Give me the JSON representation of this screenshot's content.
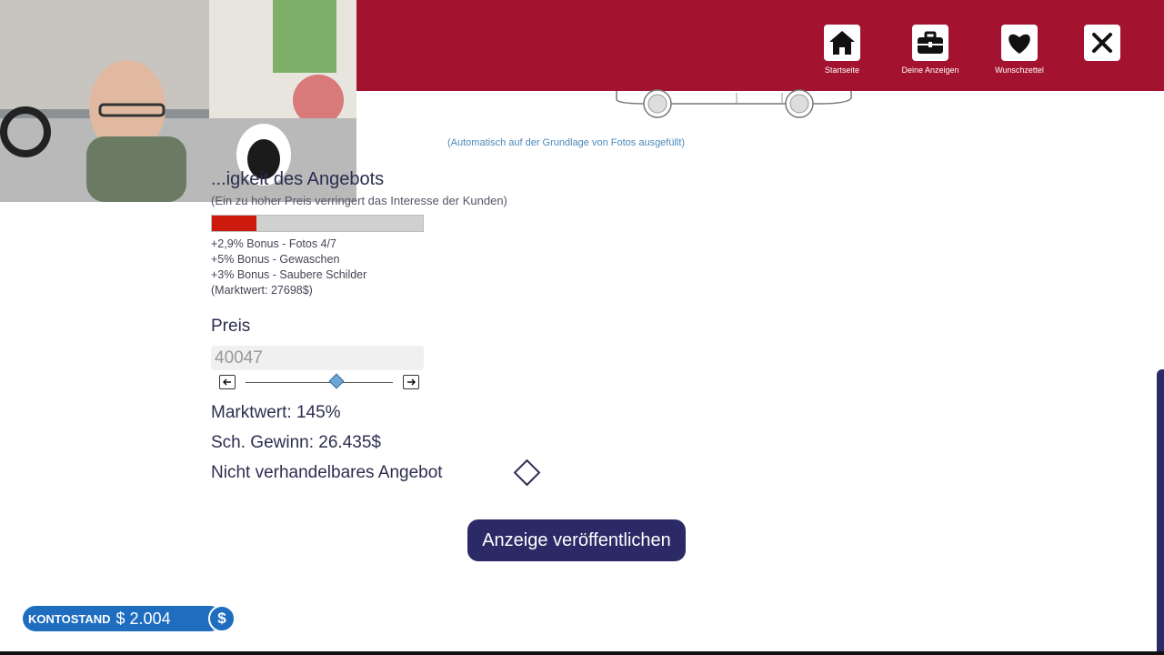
{
  "topbar": {
    "nav": [
      {
        "label": "Startseite",
        "icon": "home-icon"
      },
      {
        "label": "Deine Anzeigen",
        "icon": "briefcase-icon"
      },
      {
        "label": "Wunschzettel",
        "icon": "heart-icon"
      }
    ],
    "close_icon": "close-icon",
    "color": "#a3132f"
  },
  "auto_note": "(Automatisch auf der Grundlage von Fotos ausgefüllt)",
  "attractiveness": {
    "title": "...igkeit des Angebots",
    "subtitle": "(Ein zu hoher Preis verringert das Interesse der Kunden)",
    "level": 0.21,
    "bonuses": [
      "+2,9% Bonus - Fotos 4/7",
      "+5% Bonus - Gewaschen",
      "+3% Bonus - Saubere Schilder",
      "(Marktwert: 27698$)"
    ]
  },
  "price": {
    "label": "Preis",
    "value": "40047",
    "slider_level": 0.62
  },
  "stats": {
    "market_value": "Marktwert: 145%",
    "profit": "Sch. Gewinn: 26.435$",
    "non_negotiable": "Nicht verhandelbares Angebot"
  },
  "publish_button": "Anzeige veröffentlichen",
  "balance": {
    "label": "KONTOSTAND",
    "value": "$ 2.004",
    "icon": "$"
  },
  "colors": {
    "accent_dark": "#2c2a66",
    "bar_fill": "#cc1a0f",
    "balance_blue": "#1e6dbf"
  }
}
